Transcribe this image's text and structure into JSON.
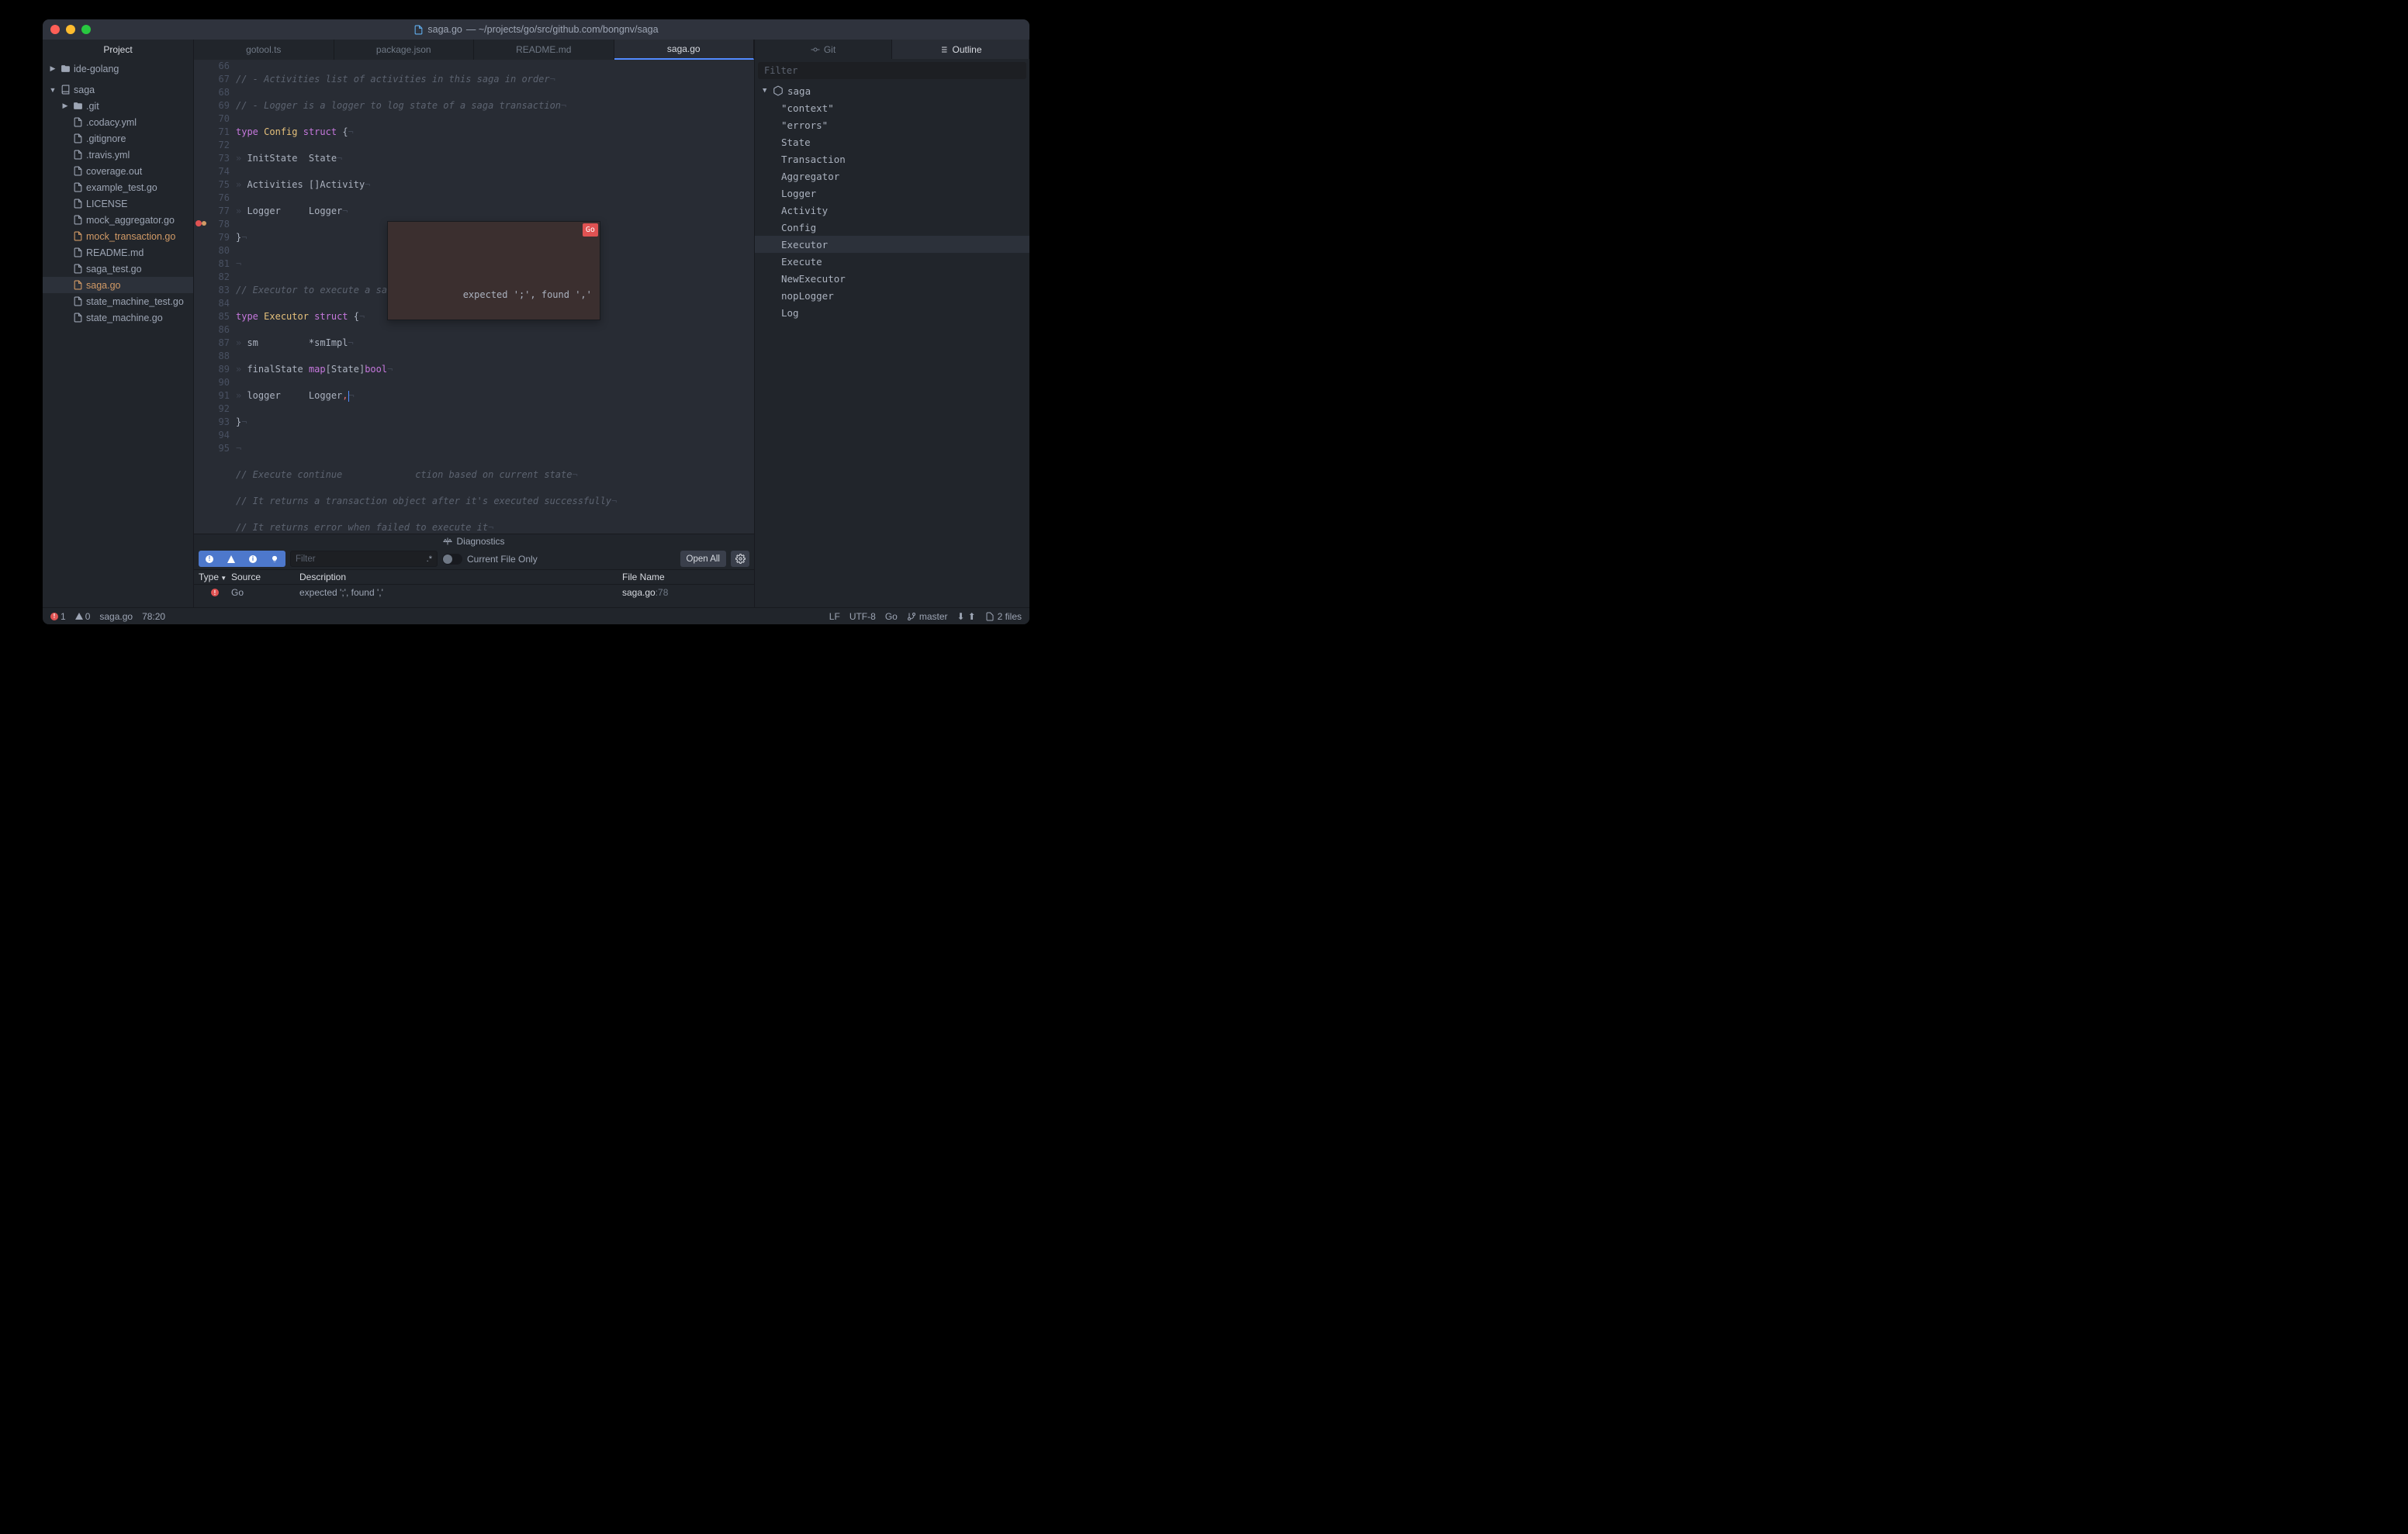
{
  "window_title_file": "saga.go",
  "window_title_path": "— ~/projects/go/src/github.com/bongnv/saga",
  "sidebar_title": "Project",
  "tree": {
    "root1": "ide-golang",
    "root2": "saga",
    "items": [
      ".git",
      ".codacy.yml",
      ".gitignore",
      ".travis.yml",
      "coverage.out",
      "example_test.go",
      "LICENSE",
      "mock_aggregator.go",
      "mock_transaction.go",
      "README.md",
      "saga_test.go",
      "saga.go",
      "state_machine_test.go",
      "state_machine.go"
    ]
  },
  "tabs": [
    "gotool.ts",
    "package.json",
    "README.md",
    "saga.go"
  ],
  "lines_start": 66,
  "tooltip": {
    "badge": "Go",
    "text": "expected ';', found ','"
  },
  "diagnostics": {
    "title": "Diagnostics",
    "filter_placeholder": "Filter",
    "regex": ".*",
    "current_only": "Current File Only",
    "open_all": "Open All",
    "cols": {
      "type": "Type",
      "src": "Source",
      "desc": "Description",
      "file": "File Name"
    },
    "row": {
      "source": "Go",
      "desc": "expected ';', found ','",
      "file": "saga.go",
      "line": ":78"
    }
  },
  "right": {
    "tab_git": "Git",
    "tab_outline": "Outline",
    "filter_placeholder": "Filter",
    "root": "saga",
    "items": [
      "\"context\"",
      "\"errors\"",
      "State",
      "Transaction",
      "Aggregator",
      "Logger",
      "Activity",
      "Config",
      "Executor",
      "Execute",
      "NewExecutor",
      "nopLogger",
      "Log"
    ]
  },
  "status": {
    "errors": "1",
    "warnings": "0",
    "file": "saga.go",
    "pos": "78:20",
    "eol": "LF",
    "enc": "UTF-8",
    "lang": "Go",
    "branch": "master",
    "files": "2 files"
  }
}
